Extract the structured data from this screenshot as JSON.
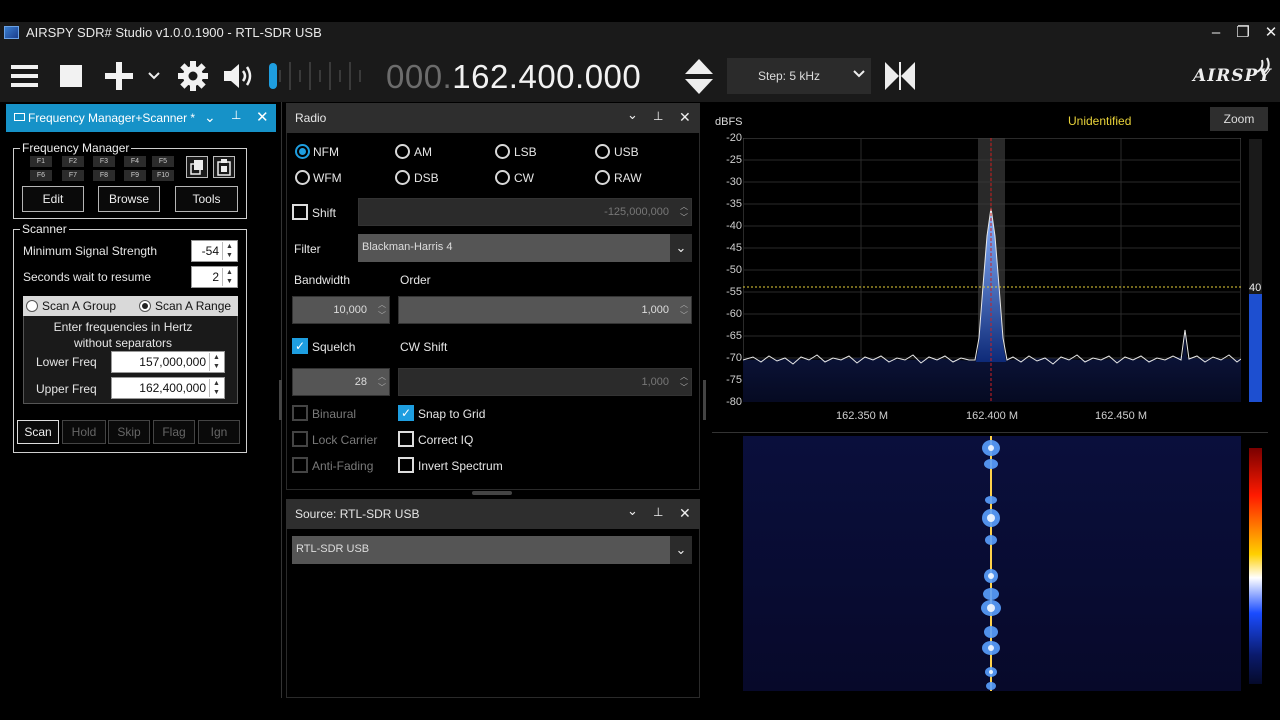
{
  "window": {
    "title": "AIRSPY SDR# Studio v1.0.0.1900 - RTL-SDR USB",
    "minimize": "–",
    "maximize": "❐",
    "close": "✕"
  },
  "toolbar": {
    "menu_icon": "hamburger-menu-icon",
    "stop_icon": "stop-icon",
    "add_icon": "plus-icon",
    "settings_icon": "gear-icon",
    "volume_icon": "speaker-icon",
    "frequency_prefix": "000.",
    "frequency_main": "162.400.000",
    "step_label": "Step: 5 kHz",
    "logo": "AIRSPY",
    "swap_icon": "bowtie-swap-icon"
  },
  "freqmanager": {
    "header": "Frequency Manager+Scanner *",
    "group_title": "Frequency Manager",
    "fkeys": [
      "F1",
      "F2",
      "F3",
      "F4",
      "F5",
      "F6",
      "F7",
      "F8",
      "F9",
      "F10"
    ],
    "edit": "Edit",
    "browse": "Browse",
    "tools": "Tools"
  },
  "scanner": {
    "group_title": "Scanner",
    "min_signal_label": "Minimum Signal Strength",
    "min_signal_value": "-54",
    "seconds_label": "Seconds wait to resume",
    "seconds_value": "2",
    "scan_group": "Scan A Group",
    "scan_range": "Scan A Range",
    "hint_line1": "Enter frequencies in Hertz",
    "hint_line2": "without separators",
    "lower_label": "Lower Freq",
    "lower_value": "157,000,000",
    "upper_label": "Upper Freq",
    "upper_value": "162,400,000",
    "buttons": [
      "Scan",
      "Hold",
      "Skip",
      "Flag",
      "Ign"
    ]
  },
  "radio": {
    "header": "Radio",
    "modes": [
      "NFM",
      "AM",
      "LSB",
      "USB",
      "WFM",
      "DSB",
      "CW",
      "RAW"
    ],
    "selected_mode": "NFM",
    "shift_label": "Shift",
    "shift_value": "-125,000,000",
    "filter_label": "Filter",
    "filter_value": "Blackman-Harris 4",
    "bandwidth_label": "Bandwidth",
    "order_label": "Order",
    "bandwidth_value": "10,000",
    "order_value": "1,000",
    "squelch_label": "Squelch",
    "cwshift_label": "CW Shift",
    "squelch_value": "28",
    "cwshift_value": "1,000",
    "binaural": "Binaural",
    "snap": "Snap to Grid",
    "lock_carrier": "Lock Carrier",
    "correct_iq": "Correct IQ",
    "anti_fading": "Anti-Fading",
    "invert": "Invert Spectrum"
  },
  "source": {
    "header": "Source: RTL-SDR USB",
    "device": "RTL-SDR USB"
  },
  "spectrum": {
    "unit": "dBFS",
    "status": "Unidentified",
    "zoom": "Zoom",
    "y_ticks": [
      "-20",
      "-25",
      "-30",
      "-35",
      "-40",
      "-45",
      "-50",
      "-55",
      "-60",
      "-65",
      "-70",
      "-75",
      "-80"
    ],
    "x_ticks": [
      "162.350 M",
      "162.400 M",
      "162.450 M"
    ],
    "squelch_level": "40"
  }
}
